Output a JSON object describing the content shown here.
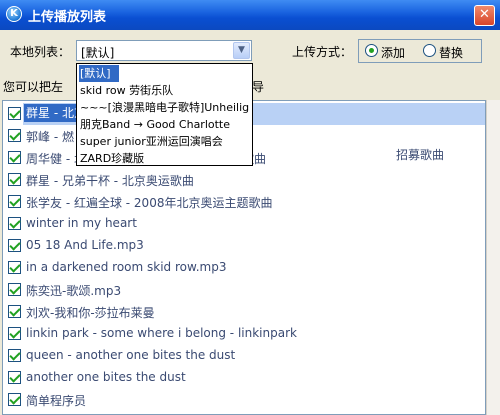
{
  "window": {
    "title": "上传播放列表"
  },
  "toolbar": {
    "local_list_label": "本地列表：",
    "local_list_value": "[默认]",
    "upload_mode_label": "上传方式：",
    "mode_add_label": "添加",
    "mode_replace_label": "替换",
    "mode_selected": "添加"
  },
  "hint": {
    "left": "您可以把左",
    "right": "导"
  },
  "dropdown": {
    "options": [
      "[默认]",
      "skid row 劳街乐队",
      "~~~[浪漫黑暗电子歌特]Unheilig",
      "朋克Band → Good Charlotte",
      "super junior亚洲运回演唱会",
      "ZARD珍藏版"
    ]
  },
  "songs": [
    "群星 - 北京",
    "郭峰 - 燃",
    "周华健 - 北京奥运会主题歌征集活动应征歌曲",
    "群星 - 兄弟干杯 - 北京奥运歌曲",
    "张学友 - 红遍全球 - 2008年北京奥运主题歌曲",
    "winter in my heart",
    "05 18 And Life.mp3",
    "in a darkened room  skid row.mp3",
    "陈奕迅-歌颂.mp3",
    "刘欢-我和你-莎拉布莱曼",
    "linkin park - some where i belong - linkinpark",
    "queen - another one bites the dust",
    "another one bites the dust",
    "简单程序员"
  ],
  "row_tail_right": "招募歌曲",
  "colors": {
    "accent": "#316ac5",
    "title_bar": "#0b4fd2",
    "check": "#21a121"
  }
}
